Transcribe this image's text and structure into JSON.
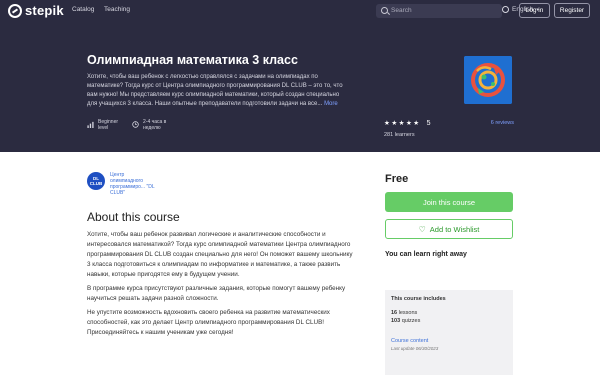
{
  "header": {
    "logo_text": "stepik",
    "nav": [
      "Catalog",
      "Teaching"
    ],
    "search_placeholder": "Search",
    "language": "English",
    "login_label": "Log in",
    "register_label": "Register"
  },
  "course": {
    "title": "Олимпиадная математика 3 класс",
    "short_description": "Хотите, чтобы ваш ребенок с легкостью справлялся с задачами на олимпиадах по математике? Тогда курс от Центра олимпиадного программирования DL CLUB – это то, что вам нужно! Мы представляем курс олимпиадной математики, который создан специально для учащихся 3 класса. Наши опытные преподаватели подготовили задачи на все...",
    "more_label": "More",
    "level": "Beginner level",
    "workload": "2-4 часа в неделю",
    "rating_stars": "★★★★★",
    "rating_value": "5",
    "reviews": "6 reviews",
    "learners": "281 learners"
  },
  "author": {
    "logo_text": "DL CLUB",
    "name": "Центр олимпиадного программиро... \"DL CLUB\""
  },
  "about": {
    "title": "About this course",
    "paragraphs": [
      "Хотите, чтобы ваш ребенок развивал логические и аналитические способности и интересовался математикой? Тогда курс олимпиадной математики Центра олимпиадного программирования DL CLUB создан специально для него! Он поможет вашему школьнику 3 класса подготовиться к олимпиадам по информатике и математике, а также развить навыки, которые пригодятся ему в будущем учении.",
      "В программе курса присутствуют различные задания, которые помогут вашему ребенку научиться решать задачи разной сложности.",
      "Не упустите возможность вдохновить своего ребенка на развитие математических способностей, как это делает Центр олимпиадного программирования DL CLUB! Присоединяйтесь к нашим ученикам уже сегодня!"
    ]
  },
  "sidebar": {
    "price": "Free",
    "join_label": "Join this course",
    "wishlist_label": "Add to Wishlist",
    "learn_now": "You can learn right away",
    "includes_title": "This course includes",
    "lessons_count": "16",
    "lessons_label": "lessons",
    "quizzes_count": "103",
    "quizzes_label": "quizzes",
    "content_link": "Course content",
    "last_update": "Last update 06/30/2023"
  },
  "colors": {
    "header_bg": "#2b2b40",
    "accent_green": "#66cc66",
    "link_blue": "#3b6fd8"
  }
}
